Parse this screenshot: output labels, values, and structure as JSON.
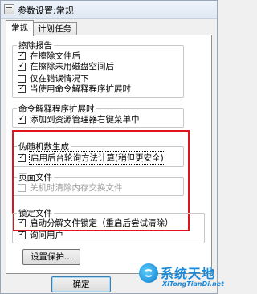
{
  "window": {
    "title": "参数设置:常规"
  },
  "tabs": [
    {
      "label": "常规"
    },
    {
      "label": "计划任务"
    }
  ],
  "groups": {
    "erase_report": {
      "legend": "擦除报告",
      "options": [
        {
          "label": "在擦除文件后",
          "checked": true
        },
        {
          "label": "在擦除未用磁盘空间后",
          "checked": true
        },
        {
          "label": "仅在错误情况下",
          "checked": false
        },
        {
          "label": "当使用命令解释程序扩展时",
          "checked": true
        }
      ]
    },
    "shell_ext": {
      "legend": "命令解释程序扩展时",
      "options": [
        {
          "label": "添加到资源管理器右键菜单中",
          "checked": true
        }
      ]
    },
    "prng": {
      "legend": "伪随机数生成",
      "options": [
        {
          "label": "启用后台轮询方法计算(稍但更安全)",
          "checked": true
        }
      ]
    },
    "page_file": {
      "legend": "页面文件",
      "options": [
        {
          "label": "关机时清除内存交换文件",
          "checked": false,
          "disabled": true
        }
      ]
    },
    "lock_file": {
      "legend": "锁定文件",
      "options": [
        {
          "label": "启动分解文件锁定（重启后尝试清除）",
          "checked": true
        },
        {
          "label": "询问用户",
          "checked": true
        }
      ]
    }
  },
  "buttons": {
    "settings_protect": "设置保护...",
    "ok": "确定"
  },
  "watermark": {
    "title": "系统天地",
    "subtitle": "XiTongTianDi.net"
  },
  "colors": {
    "highlight_box": "#e0141c",
    "watermark": "#1a88d8"
  }
}
